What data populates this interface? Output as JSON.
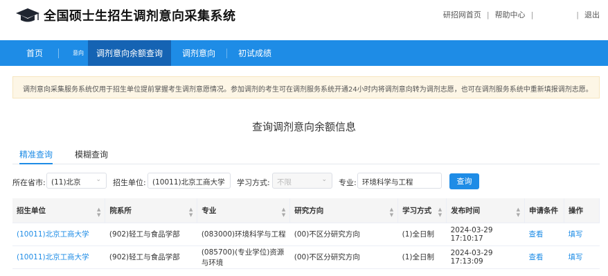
{
  "header": {
    "title": "全国硕士生招生调剂意向采集系统",
    "links": [
      "研招网首页",
      "帮助中心",
      "退出"
    ]
  },
  "nav": {
    "home": "首页",
    "small": "意向",
    "items": [
      "调剂意向余额查询",
      "调剂意向",
      "初试成绩"
    ]
  },
  "notice": "调剂意向采集服务系统仅用于招生单位提前掌握考生调剂意愿情况。参加调剂的考生可在调剂服务系统开通24小时内将调剂意向转为调剂志愿，也可在调剂服务系统中重新填报调剂志愿。",
  "heading": "查询调剂意向余额信息",
  "tabs": [
    "精准查询",
    "模糊查询"
  ],
  "filter": {
    "province_label": "所在省市:",
    "province_value": "(11)北京",
    "unit_label": "招生单位:",
    "unit_value": "(10011)北京工商大学",
    "mode_label": "学习方式:",
    "mode_value": "不限",
    "major_label": "专业:",
    "major_value": "环境科学与工程",
    "search_label": "查询"
  },
  "table": {
    "columns": [
      "招生单位",
      "院系所",
      "专业",
      "研究方向",
      "学习方式",
      "发布时间",
      "申请条件",
      "操作"
    ],
    "rows": [
      [
        "(10011)北京工商大学",
        "(902)轻工与食品学部",
        "(083000)环境科学与工程",
        "(00)不区分研究方向",
        "(1)全日制",
        "2024-03-29 17:10:17",
        "查看",
        "填写"
      ],
      [
        "(10011)北京工商大学",
        "(902)轻工与食品学部",
        "(085700)(专业学位)资源与环境",
        "(00)不区分研究方向",
        "(1)全日制",
        "2024-03-29 17:13:09",
        "查看",
        "填写"
      ]
    ]
  },
  "colors": {
    "primary": "#1e8ce6",
    "nav_active": "#1563b3",
    "notice_bg": "#fdf6e6"
  }
}
